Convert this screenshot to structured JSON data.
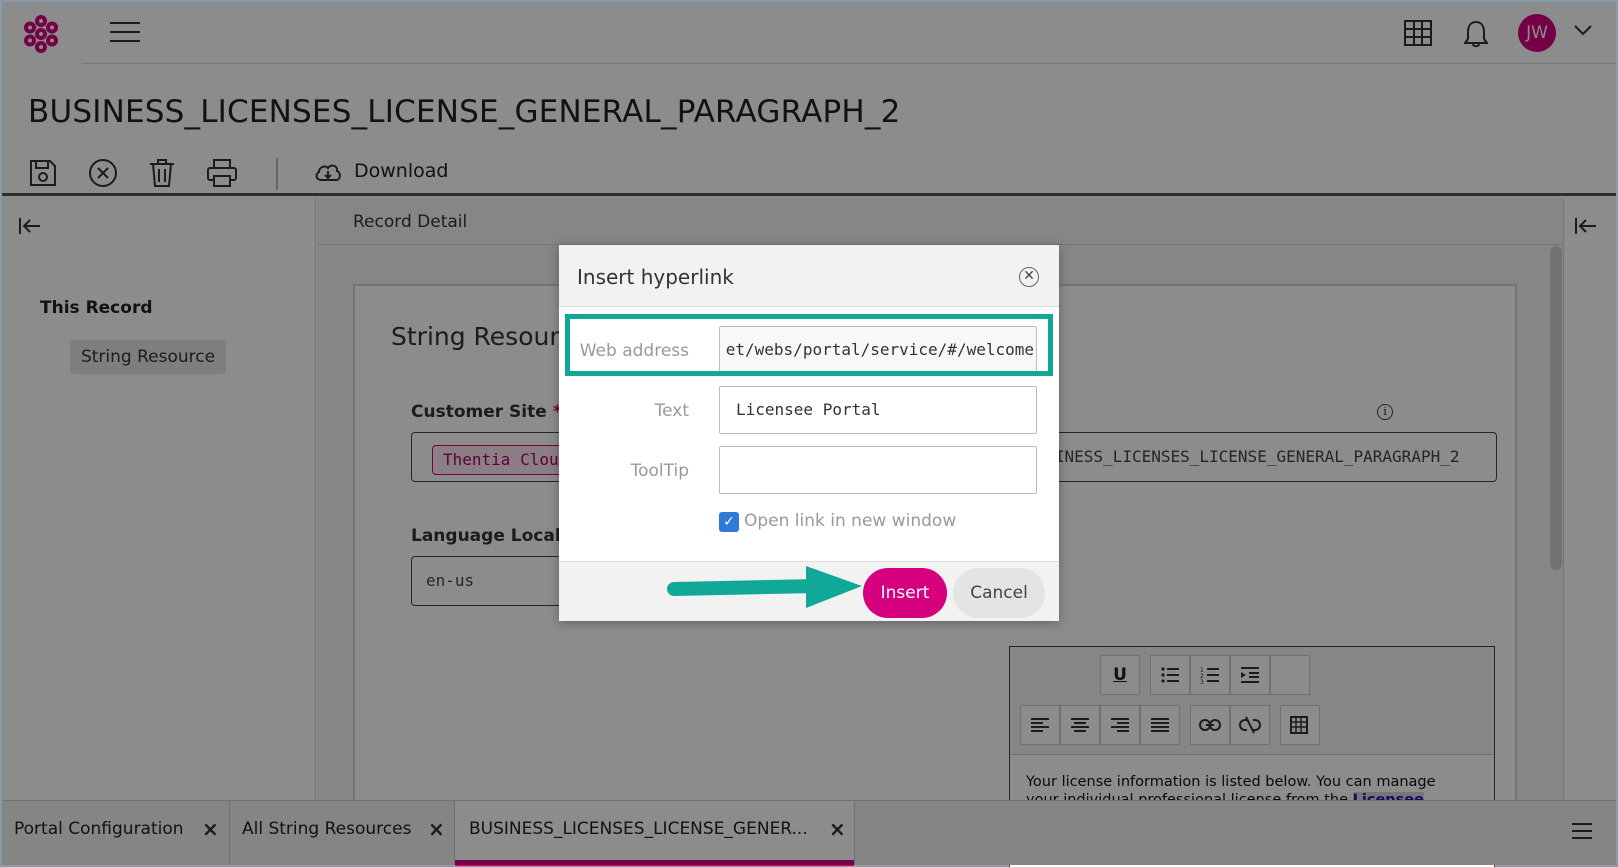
{
  "header": {
    "user_initials": "JW",
    "brand_color": "#d6007f"
  },
  "page": {
    "title": "BUSINESS_LICENSES_LICENSE_GENERAL_PARAGRAPH_2",
    "download_label": "Download"
  },
  "left_panel": {
    "heading": "This Record",
    "item": "String Resource"
  },
  "main": {
    "section_label": "Record Detail",
    "card_title": "String Resource",
    "customer_site_label": "Customer Site",
    "required_mark": "*",
    "customer_site_tag": "Thentia Cloud",
    "language_locale_label": "Language Locale",
    "language_locale_value": "en-us",
    "name_value": "BUSINESS_LICENSES_LICENSE_GENERAL_PARAGRAPH_2",
    "editor": {
      "underline_label": "U",
      "text_before": "Your license information is listed below. You can manage your individual professional license from the ",
      "link_text": "Licensee Portal",
      "text_after": "."
    }
  },
  "dialog": {
    "title": "Insert hyperlink",
    "web_address_label": "Web address",
    "web_address_value": "et/webs/portal/service/#/welcome",
    "text_label": "Text",
    "text_value": "Licensee Portal",
    "tooltip_label": "ToolTip",
    "tooltip_value": "",
    "new_window_label": "Open link in new window",
    "new_window_checked": true,
    "insert_label": "Insert",
    "cancel_label": "Cancel",
    "highlight_color": "#12a898"
  },
  "bottom_tabs": [
    {
      "label": "Portal Configuration"
    },
    {
      "label": "All String Resources"
    },
    {
      "label": "BUSINESS_LICENSES_LICENSE_GENER..."
    }
  ]
}
